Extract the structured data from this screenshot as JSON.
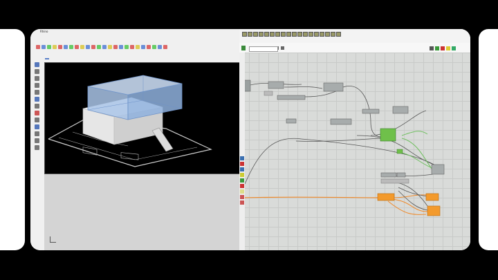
{
  "rhino": {
    "title": "Rhino",
    "subtitle": "",
    "menu": [
      "",
      "",
      "",
      "",
      "",
      "",
      "",
      "",
      "",
      "",
      "",
      "",
      "",
      "",
      "",
      "",
      "",
      "",
      ""
    ],
    "tabs": [
      "",
      "",
      "",
      "",
      "",
      "",
      "",
      "",
      "",
      "",
      "",
      "",
      "",
      ""
    ],
    "viewport_label": "",
    "viewport_label2": ""
  },
  "grasshopper": {
    "file_tab": ""
  },
  "watermark": ""
}
